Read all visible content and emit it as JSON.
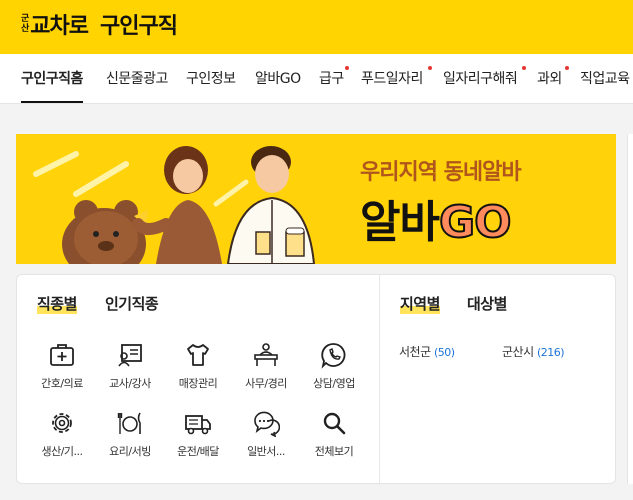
{
  "header": {
    "logo_sub_top": "군",
    "logo_sub_bottom": "산",
    "logo_main": "교차로",
    "title": "구인구직"
  },
  "nav": {
    "items": [
      {
        "label": "구인구직홈",
        "active": true,
        "dot": false
      },
      {
        "label": "신문줄광고",
        "dot": false
      },
      {
        "label": "구인정보",
        "dot": false
      },
      {
        "label": "알바GO",
        "dot": false
      },
      {
        "label": "급구",
        "dot": true
      },
      {
        "label": "푸드일자리",
        "dot": true
      },
      {
        "label": "일자리구해줘",
        "dot": true
      },
      {
        "label": "과외",
        "dot": true
      },
      {
        "label": "직업교육",
        "dot": false
      }
    ]
  },
  "banner": {
    "line1": "우리지역 동네알바",
    "line2_a": "알바",
    "line2_b": "GO"
  },
  "categories": {
    "tabs": [
      "직종별",
      "인기직종"
    ],
    "items": [
      {
        "label": "간호/의료",
        "icon": "first-aid-kit-icon"
      },
      {
        "label": "교사/강사",
        "icon": "teacher-board-icon"
      },
      {
        "label": "매장관리",
        "icon": "shirt-icon"
      },
      {
        "label": "사무/경리",
        "icon": "office-desk-icon"
      },
      {
        "label": "상담/영업",
        "icon": "phone-bubble-icon"
      },
      {
        "label": "생산/기...",
        "icon": "gear-icon"
      },
      {
        "label": "요리/서빙",
        "icon": "fork-knife-icon"
      },
      {
        "label": "운전/배달",
        "icon": "truck-icon"
      },
      {
        "label": "일반서...",
        "icon": "chat-bubbles-icon"
      },
      {
        "label": "전체보기",
        "icon": "search-icon"
      }
    ]
  },
  "regions": {
    "tabs": [
      "지역별",
      "대상별"
    ],
    "items": [
      {
        "name": "서천군",
        "count": "(50)"
      },
      {
        "name": "군산시",
        "count": "(216)"
      }
    ]
  }
}
